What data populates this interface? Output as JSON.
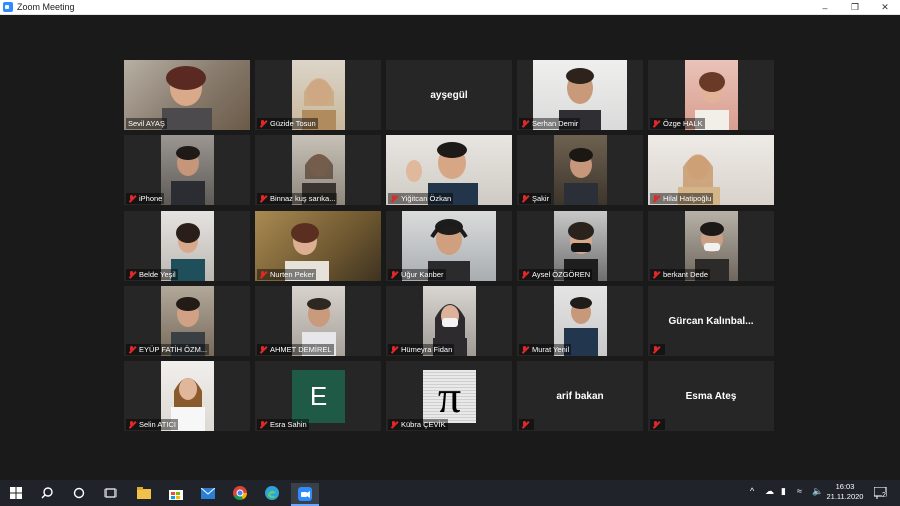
{
  "window": {
    "title": "Zoom Meeting"
  },
  "participants": [
    {
      "name": "Sevil AYAŞ",
      "video": true,
      "active": true
    },
    {
      "name": "Güzide Tosun",
      "video": true
    },
    {
      "name": "ayşegül",
      "video": false
    },
    {
      "name": "Serhan Demir",
      "video": true
    },
    {
      "name": "Özge HALK",
      "video": true
    },
    {
      "name": "iPhone",
      "video": true
    },
    {
      "name": "Binnaz kuş sarıka...",
      "video": true
    },
    {
      "name": "Yiğitcan Özkan",
      "video": true
    },
    {
      "name": "Şakir",
      "video": true
    },
    {
      "name": "Hilal Hatipoğlu",
      "video": true
    },
    {
      "name": "Belde Yeşil",
      "video": true
    },
    {
      "name": "Nurten Peker",
      "video": true
    },
    {
      "name": "Uğur Kanber",
      "video": true
    },
    {
      "name": "Aysel ÖZGÖREN",
      "video": true
    },
    {
      "name": "berkant Dede",
      "video": true
    },
    {
      "name": "EYÜP FATİH ÖZM...",
      "video": true
    },
    {
      "name": "AHMET DEMİREL",
      "video": true
    },
    {
      "name": "Hümeyra Fidan",
      "video": true
    },
    {
      "name": "Murat Yenil",
      "video": true
    },
    {
      "name": "Gürcan Kalınbal...",
      "video": false
    },
    {
      "name": "Selin ATICI",
      "video": true
    },
    {
      "name": "Esra Sahin",
      "video": false,
      "avatar_letter": "E"
    },
    {
      "name": "Kübra ÇEVİK",
      "video": false,
      "avatar_symbol": "π"
    },
    {
      "name": "arif bakan",
      "video": false
    },
    {
      "name": "Esma Ateş",
      "video": false
    }
  ],
  "taskbar": {
    "time": "16:03",
    "date": "21.11.2020",
    "notification_count": "2"
  },
  "colors": {
    "active_speaker_border": "#d7e56a",
    "muted_icon": "#e02828",
    "tile_background": "#262626",
    "meeting_background": "#1a1a1a"
  }
}
